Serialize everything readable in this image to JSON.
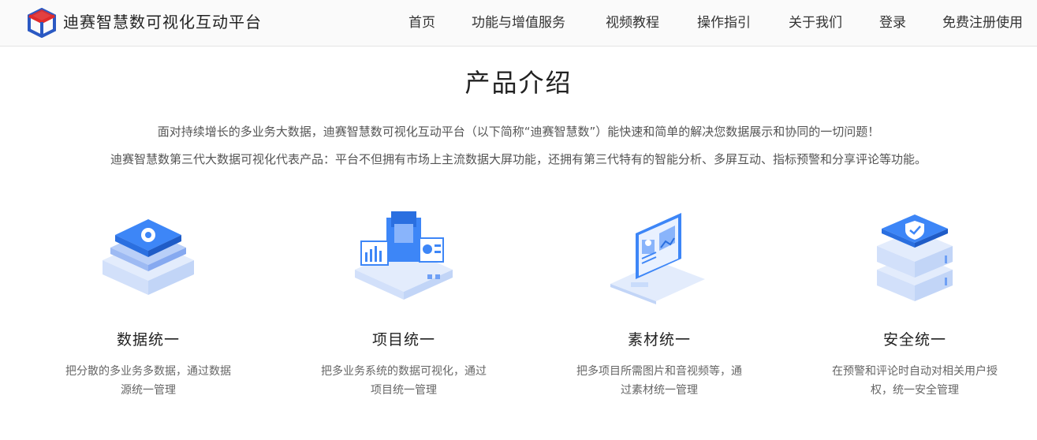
{
  "header": {
    "brand": "迪赛智慧数可视化互动平台",
    "nav": [
      "首页",
      "功能与增值服务",
      "视频教程",
      "操作指引",
      "关于我们",
      "登录",
      "免费注册使用"
    ]
  },
  "section": {
    "title": "产品介绍",
    "intro_line1": "面对持续增长的多业务大数据，迪赛智慧数可视化互动平台（以下简称“迪赛智慧数”）能快速和简单的解决您数据展示和协同的一切问题！",
    "intro_line2": "迪赛智慧数第三代大数据可视化代表产品：平台不但拥有市场上主流数据大屏功能，还拥有第三代特有的智能分析、多屏互动、指标预警和分享评论等功能。"
  },
  "features": [
    {
      "title": "数据统一",
      "desc": "把分散的多业务多数据，通过数据源统一管理",
      "icon": "gear-stack-icon"
    },
    {
      "title": "项目统一",
      "desc": "把多业务系统的数据可视化，通过项目统一管理",
      "icon": "chip-dashboard-icon"
    },
    {
      "title": "素材统一",
      "desc": "把多项目所需图片和音视频等，通过素材统一管理",
      "icon": "laptop-media-icon"
    },
    {
      "title": "安全统一",
      "desc": "在预警和评论时自动对相关用户授权，统一安全管理",
      "icon": "shield-server-icon"
    }
  ],
  "colors": {
    "brand_red": "#e02b2b",
    "brand_blue": "#2b59c3",
    "accent_blue": "#2f7cf6",
    "light_blue": "#c9dcfb"
  }
}
